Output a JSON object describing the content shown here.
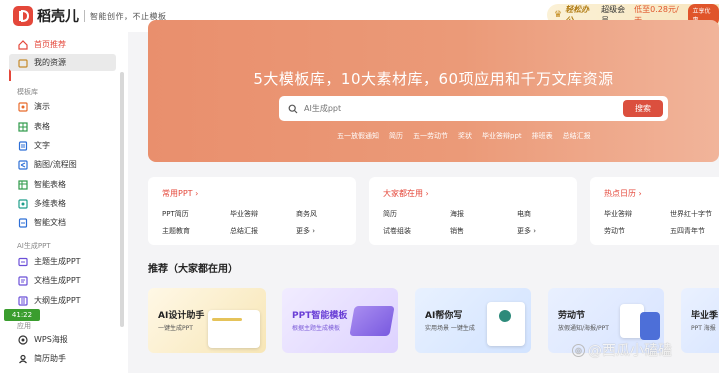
{
  "header": {
    "app_name": "稻壳儿",
    "tagline": "智能创作，不止模板",
    "promo": {
      "brand": "轻松办公",
      "member": "超级会员",
      "price": "低至0.28元/天",
      "button": "立享优惠"
    }
  },
  "sidebar": {
    "top_items": [
      {
        "label": "首页推荐",
        "icon": "home-icon"
      },
      {
        "label": "我的资源",
        "icon": "folder-icon"
      }
    ],
    "section_templates": "模板库",
    "template_items": [
      {
        "label": "演示",
        "icon": "presentation-icon"
      },
      {
        "label": "表格",
        "icon": "table-icon"
      },
      {
        "label": "文字",
        "icon": "document-icon"
      },
      {
        "label": "脑图/流程图",
        "icon": "mindmap-icon"
      },
      {
        "label": "智能表格",
        "icon": "smart-table-icon"
      },
      {
        "label": "多维表格",
        "icon": "multi-table-icon"
      },
      {
        "label": "智能文档",
        "icon": "smart-doc-icon"
      }
    ],
    "section_ai": "AI生成PPT",
    "ai_items": [
      {
        "label": "主题生成PPT",
        "icon": "topic-ppt-icon"
      },
      {
        "label": "文档生成PPT",
        "icon": "doc-ppt-icon"
      },
      {
        "label": "大纲生成PPT",
        "icon": "outline-ppt-icon"
      }
    ],
    "section_apps": "应用",
    "app_items": [
      {
        "label": "WPS海报",
        "icon": "poster-icon"
      },
      {
        "label": "简历助手",
        "icon": "resume-icon"
      }
    ],
    "time_badge": "41:22"
  },
  "hero": {
    "title": "5大模板库，10大素材库，60项应用和千万文库资源",
    "search_placeholder": "AI生成ppt",
    "search_button": "搜索",
    "hot_tags": [
      "五一放假通知",
      "简历",
      "五一劳动节",
      "奖状",
      "毕业答辩ppt",
      "排班表",
      "总结汇报"
    ]
  },
  "cards": [
    {
      "title": "常用PPT",
      "items": [
        "PPT简历",
        "毕业答辩",
        "商务风",
        "主题教育",
        "总结汇报",
        "更多"
      ]
    },
    {
      "title": "大家都在用",
      "items": [
        "简历",
        "海报",
        "电商",
        "试卷组装",
        "销售",
        "更多"
      ]
    },
    {
      "title": "热点日历",
      "items": [
        "毕业答辩",
        "世界红十字节",
        "劳动节",
        "五四青年节"
      ]
    }
  ],
  "recommend": {
    "title": "推荐（大家都在用）",
    "tiles": [
      {
        "title": "AI设计助手",
        "sub": "一键生成PPT"
      },
      {
        "title": "PPT智能模板",
        "sub": "根据主题生成模板"
      },
      {
        "title": "AI帮你写",
        "sub": "实用场景 一键生成"
      },
      {
        "title": "劳动节",
        "sub": "放假通知/海报/PPT"
      },
      {
        "title": "毕业季",
        "sub": "PPT 海报"
      }
    ]
  },
  "watermark": "@西瓜小磕磕"
}
